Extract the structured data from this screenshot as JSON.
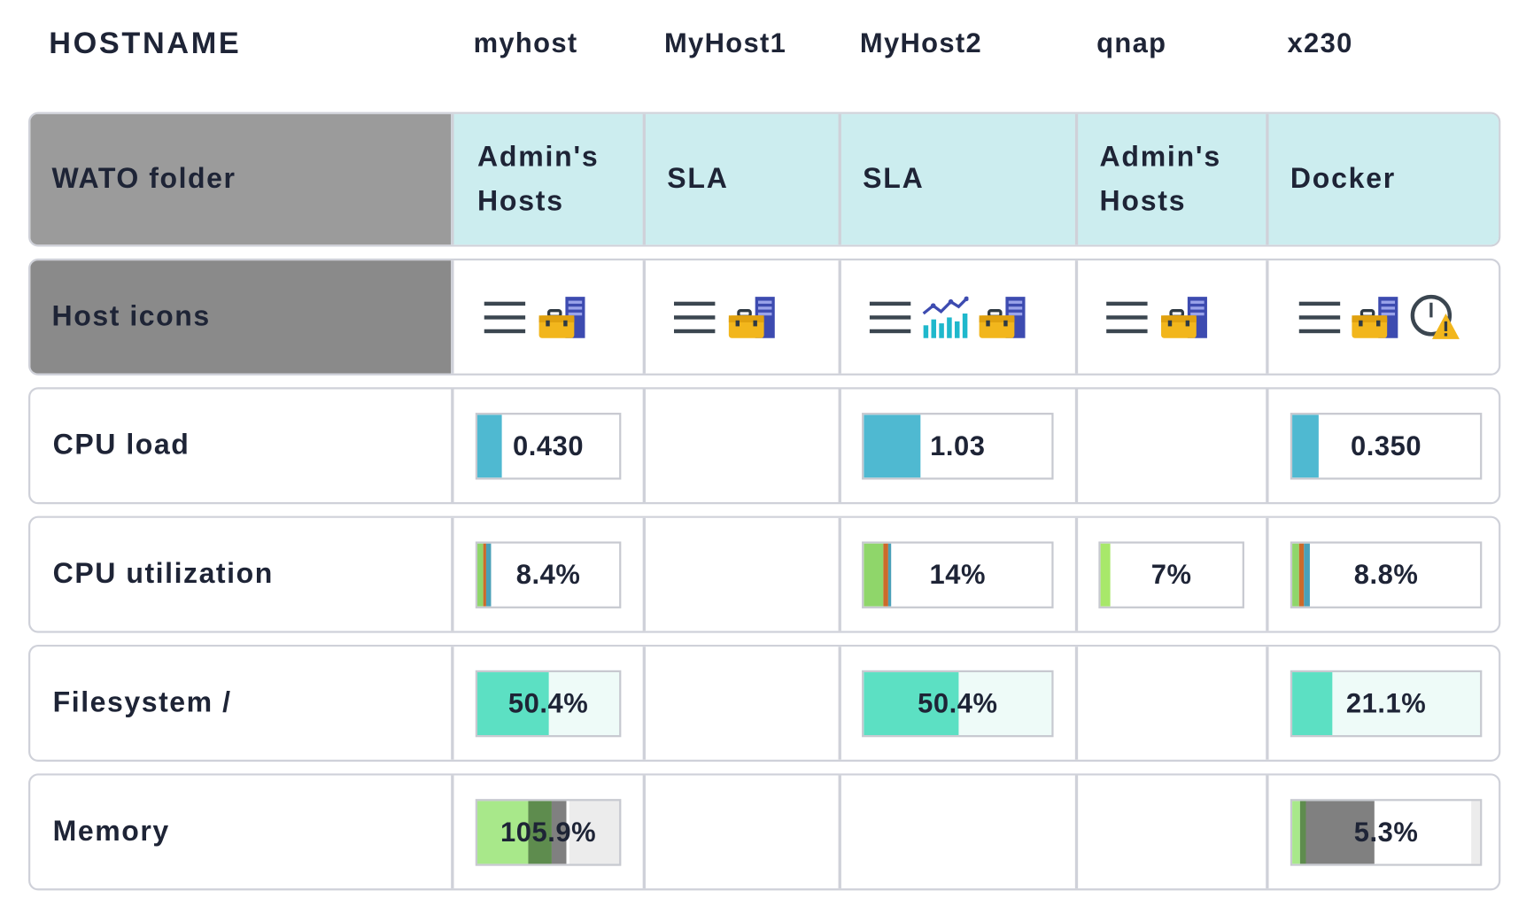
{
  "header": {
    "title": "HOSTNAME",
    "hosts": [
      "myhost",
      "MyHost1",
      "MyHost2",
      "qnap",
      "x230"
    ]
  },
  "rows": {
    "wato_folder": {
      "label": "WATO folder",
      "values": [
        [
          "Admin's",
          "Hosts"
        ],
        [
          "SLA"
        ],
        [
          "SLA"
        ],
        [
          "Admin's",
          "Hosts"
        ],
        [
          "Docker"
        ]
      ]
    },
    "host_icons": {
      "label": "Host icons",
      "icons": [
        [
          "menu-icon",
          "wato-toolbox-icon"
        ],
        [
          "menu-icon",
          "wato-toolbox-icon"
        ],
        [
          "menu-icon",
          "graph-icon",
          "wato-toolbox-icon"
        ],
        [
          "menu-icon",
          "wato-toolbox-icon"
        ],
        [
          "menu-icon",
          "wato-toolbox-icon",
          "stale-warning-icon"
        ]
      ]
    },
    "cpu_load": {
      "label": "CPU load",
      "values": [
        "0.430",
        "",
        "1.03",
        "",
        "0.350"
      ],
      "fill": [
        0.17,
        null,
        0.3,
        null,
        0.14
      ]
    },
    "cpu_utilization": {
      "label": "CPU utilization",
      "values": [
        "8.4%",
        "",
        "14%",
        "7%",
        "8.8%"
      ]
    },
    "filesystem": {
      "label": "Filesystem /",
      "values": [
        "50.4%",
        "",
        "50.4%",
        "",
        "21.1%"
      ],
      "fill": [
        0.504,
        null,
        0.504,
        null,
        0.211
      ]
    },
    "memory": {
      "label": "Memory",
      "values": [
        "105.9%",
        "",
        "",
        "",
        "5.3%"
      ]
    }
  },
  "colors": {
    "folder_cell": "#ccedef",
    "label_gray": "#9b9b9b",
    "label_gray_dark": "#8a8a8a",
    "cpu_load": "#4fb9d1",
    "filesystem": "#5ce0c3",
    "filesystem_bg": "#eefbf8",
    "cpu_user": "#8fd66a",
    "cpu_system": "#cc6a2a",
    "cpu_wait": "#4aa0b8",
    "mem_ram": "#a8e88a",
    "mem_swap": "#5e8c4e",
    "mem_other": "#808080",
    "mem_bg": "#ececec"
  }
}
